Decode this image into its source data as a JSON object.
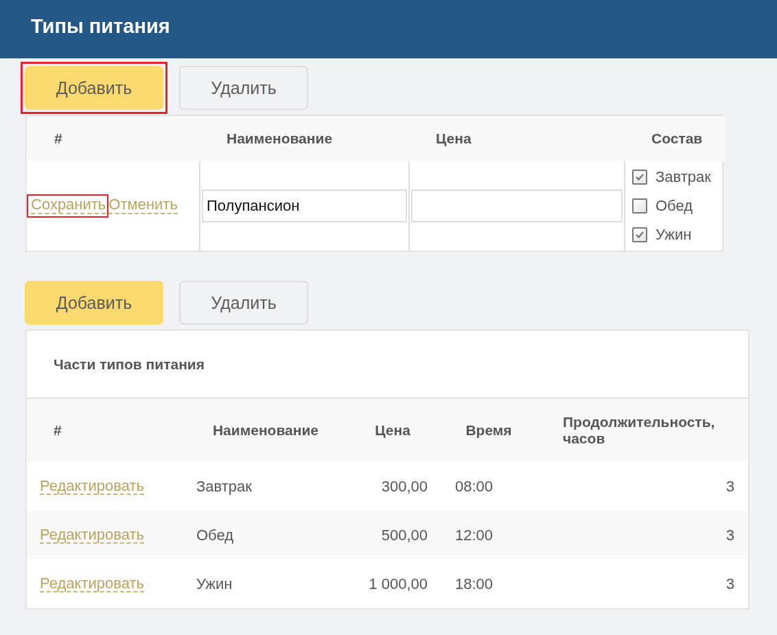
{
  "header": {
    "title": "Типы питания"
  },
  "toolbar_1": {
    "buttons": [
      {
        "kind": "primary",
        "label": "Добавить",
        "highlighted": true
      },
      {
        "kind": "secondary",
        "label": "Удалить",
        "highlighted": false
      }
    ]
  },
  "edit_table": {
    "columns": [
      "#",
      "Наименование",
      "Цена",
      "Состав"
    ],
    "row": {
      "actions": [
        {
          "label": "Сохранить",
          "highlighted": true
        },
        {
          "label": "Отменить",
          "highlighted": false
        }
      ],
      "name": {
        "value": "Полупансион"
      },
      "composition": [
        {
          "label": "Завтрак",
          "checked": true
        },
        {
          "label": "Обед",
          "checked": false
        },
        {
          "label": "Ужин",
          "checked": true
        }
      ]
    }
  },
  "toolbar_2": {
    "buttons": [
      {
        "kind": "primary",
        "label": "Добавить",
        "highlighted": false
      },
      {
        "kind": "secondary",
        "label": "Удалить",
        "highlighted": false
      }
    ]
  },
  "parts_table": {
    "caption": "Части типов питания",
    "columns": [
      "#",
      "Наименование",
      "Цена",
      "Время",
      "Продолжительность, часов"
    ],
    "rows": [
      {
        "action": "Редактировать",
        "name": "Завтрак",
        "price": "300,00",
        "time": "08:00",
        "duration": "3"
      },
      {
        "action": "Редактировать",
        "name": "Обед",
        "price": "500,00",
        "time": "12:00",
        "duration": "3"
      },
      {
        "action": "Редактировать",
        "name": "Ужин",
        "price": "1 000,00",
        "time": "18:00",
        "duration": "3"
      }
    ]
  }
}
